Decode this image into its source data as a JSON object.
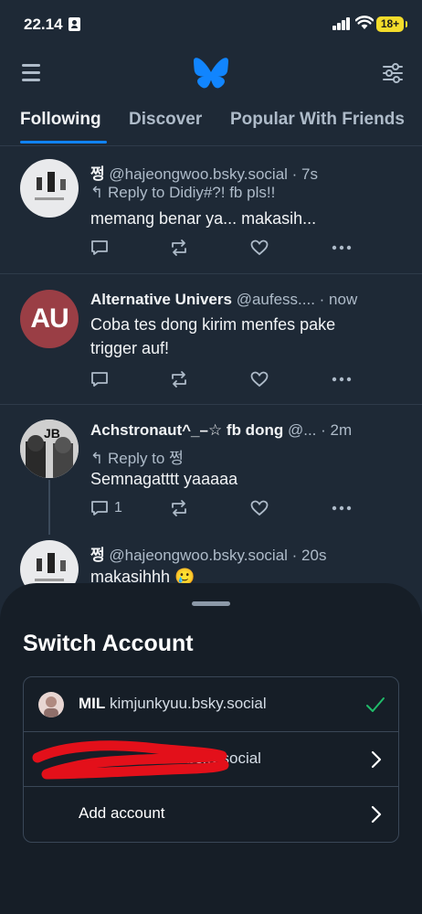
{
  "status_bar": {
    "time": "22.14",
    "battery": "18+"
  },
  "tabs": [
    "Following",
    "Discover",
    "Popular With Friends"
  ],
  "posts": [
    {
      "name": "쩡",
      "handle": "@hajeongwoo.bsky.social",
      "time": "· 7s",
      "reply_to": "Reply to Didiy#?! fb pls!!",
      "text": "memang benar ya... makasih...",
      "reply_count": ""
    },
    {
      "name": "Alternative Univers",
      "handle": "@aufess....",
      "time": "· now",
      "reply_to": "",
      "text": "Coba tes dong kirim menfes pake trigger auf!",
      "reply_count": "",
      "avatar_text": "AU"
    },
    {
      "name": "Achstronaut^_–☆ fb dong",
      "handle": "@...",
      "time": "· 2m",
      "reply_to": "Reply to 쩡",
      "text": "Semnagatttt yaaaaa",
      "reply_count": "1"
    },
    {
      "name": "쩡",
      "handle": "@hajeongwoo.bsky.social",
      "time": "· 20s",
      "reply_to": "",
      "text": "makasihhh 🥲",
      "reply_count": ""
    }
  ],
  "switch_account": {
    "title": "Switch Account",
    "accounts": [
      {
        "display_name": "MIL",
        "handle": "kimjunkyuu.bsky.social",
        "selected": true
      },
      {
        "display_name": "",
        "handle": "...wan.bsky.social",
        "selected": false
      }
    ],
    "add_account_label": "Add account"
  },
  "colors": {
    "accent": "#1083fe",
    "background": "#1e2936",
    "sheet": "#161e27",
    "check": "#20bc6a",
    "redaction": "#e3101a"
  }
}
